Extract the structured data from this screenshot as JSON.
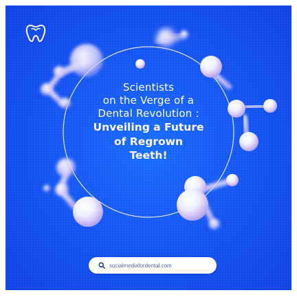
{
  "brand": {
    "logo_icon": "tooth-icon"
  },
  "headline": {
    "lines_regular": [
      "Scientists",
      "on the Verge of a",
      "Dental Revolution :"
    ],
    "lines_bold": [
      "Unveiling a Future",
      "of Regrown",
      "Teeth!"
    ]
  },
  "search": {
    "icon": "search-icon",
    "text": "socialmediafordental.com"
  },
  "colors": {
    "background": "#1552f0",
    "text": "#ffffff",
    "molecule_highlight": "#e8ecff",
    "molecule_tint": "#c9a6f2",
    "search_text": "#5a6b9a"
  }
}
